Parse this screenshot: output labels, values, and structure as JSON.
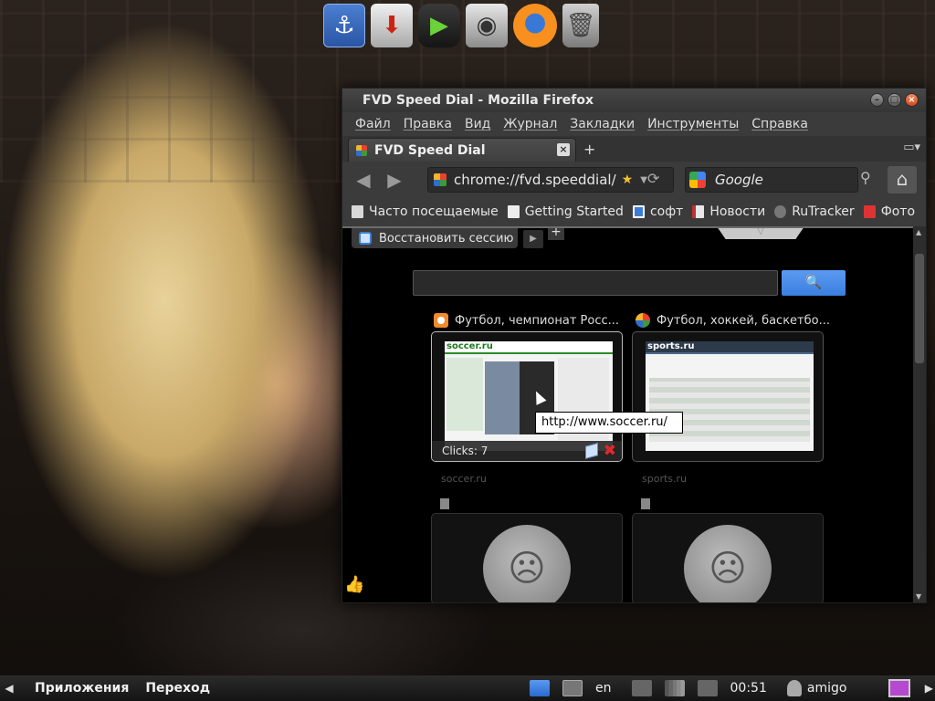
{
  "window": {
    "title": "FVD Speed Dial - Mozilla Firefox"
  },
  "menu": [
    "Файл",
    "Правка",
    "Вид",
    "Журнал",
    "Закладки",
    "Инструменты",
    "Справка"
  ],
  "tab": {
    "title": "FVD Speed Dial"
  },
  "navbar": {
    "url": "chrome://fvd.speeddial/",
    "search_engine_placeholder": "Google"
  },
  "bookmarks": [
    "Часто посещаемые",
    "Getting Started",
    "софт",
    "Новости",
    "RuTracker",
    "Фото"
  ],
  "speeddial": {
    "restore_label": "Восстановить сессию",
    "dials": [
      {
        "title": "Футбол, чемпионат Росс...",
        "site_logo": "soccer.ru",
        "clicks": "Clicks: 7",
        "url": "soccer.ru"
      },
      {
        "title": "Футбол, хоккей, баскетбо...",
        "site_logo": "sports.ru",
        "url": "sports.ru"
      }
    ],
    "tooltip": "http://www.soccer.ru/"
  },
  "panel": {
    "applications": "Приложения",
    "goto": "Переход",
    "lang": "en",
    "time": "00:51",
    "user": "amigo"
  }
}
